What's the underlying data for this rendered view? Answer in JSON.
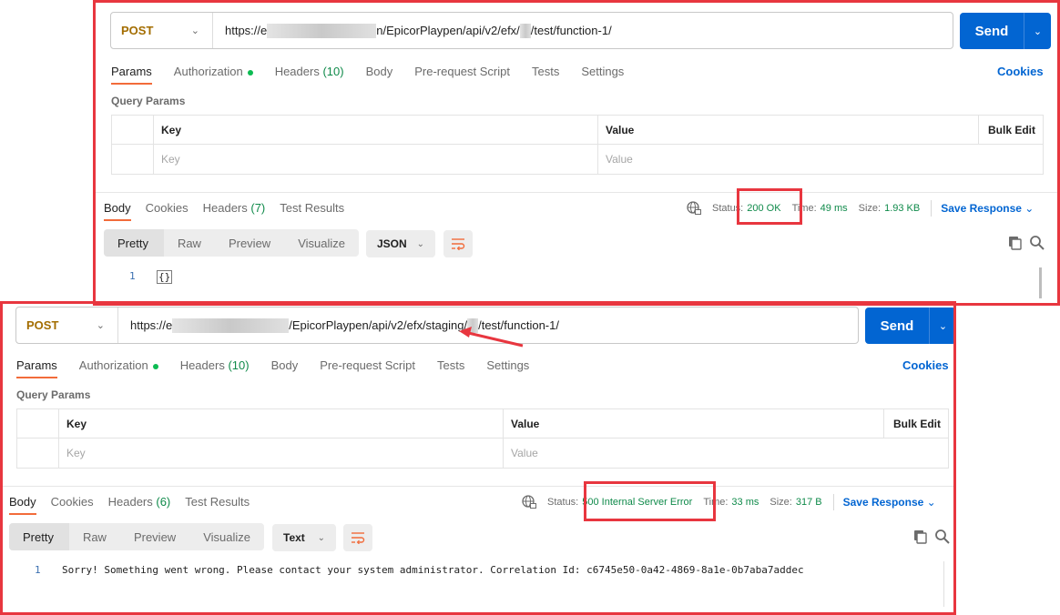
{
  "top": {
    "method": "POST",
    "url_prefix": "https://e",
    "url_mid": "n/EpicorPlaypen/api/v2/efx/",
    "url_mid2": "",
    "url_suffix": "/test/function-1/",
    "send_label": "Send",
    "tabs": [
      {
        "label": "Params",
        "active": true
      },
      {
        "label": "Authorization",
        "dot": true
      },
      {
        "label": "Headers",
        "count": "(10)"
      },
      {
        "label": "Body"
      },
      {
        "label": "Pre-request Script"
      },
      {
        "label": "Tests"
      },
      {
        "label": "Settings"
      }
    ],
    "cookies_label": "Cookies",
    "query_params_title": "Query Params",
    "table": {
      "key_header": "Key",
      "value_header": "Value",
      "bulk_edit": "Bulk Edit",
      "key_placeholder": "Key",
      "value_placeholder": "Value"
    },
    "response_tabs": [
      {
        "label": "Body",
        "active": true
      },
      {
        "label": "Cookies"
      },
      {
        "label": "Headers",
        "count": "(7)"
      },
      {
        "label": "Test Results"
      }
    ],
    "status_label": "Status:",
    "status_value": "200 OK",
    "time_label": "Time:",
    "time_value": "49 ms",
    "size_label": "Size:",
    "size_value": "1.93 KB",
    "save_response": "Save Response",
    "view_modes": [
      "Pretty",
      "Raw",
      "Preview",
      "Visualize"
    ],
    "format": "JSON",
    "line_number": "1",
    "body_line": "{}"
  },
  "bottom": {
    "method": "POST",
    "url_prefix": "https://e",
    "url_mid": "/EpicorPlaypen/api/v2/efx/staging/",
    "url_suffix": "/test/function-1/",
    "send_label": "Send",
    "tabs": [
      {
        "label": "Params",
        "active": true
      },
      {
        "label": "Authorization",
        "dot": true
      },
      {
        "label": "Headers",
        "count": "(10)"
      },
      {
        "label": "Body"
      },
      {
        "label": "Pre-request Script"
      },
      {
        "label": "Tests"
      },
      {
        "label": "Settings"
      }
    ],
    "cookies_label": "Cookies",
    "query_params_title": "Query Params",
    "table": {
      "key_header": "Key",
      "value_header": "Value",
      "bulk_edit": "Bulk Edit",
      "key_placeholder": "Key",
      "value_placeholder": "Value"
    },
    "response_tabs": [
      {
        "label": "Body",
        "active": true
      },
      {
        "label": "Cookies"
      },
      {
        "label": "Headers",
        "count": "(6)"
      },
      {
        "label": "Test Results"
      }
    ],
    "status_label": "Status:",
    "status_value": "500 Internal Server Error",
    "time_label": "Time:",
    "time_value": "33 ms",
    "size_label": "Size:",
    "size_value": "317 B",
    "save_response": "Save Response",
    "view_modes": [
      "Pretty",
      "Raw",
      "Preview",
      "Visualize"
    ],
    "format": "Text",
    "line_number": "1",
    "body_line": "Sorry! Something went wrong. Please contact your system administrator. Correlation Id: c6745e50-0a42-4869-8a1e-0b7aba7addec"
  },
  "colors": {
    "accent": "#0265d2",
    "highlight": "#e8363f",
    "success": "#0f8a4a",
    "method": "#a36d00",
    "active_tab": "#f26b3a"
  }
}
